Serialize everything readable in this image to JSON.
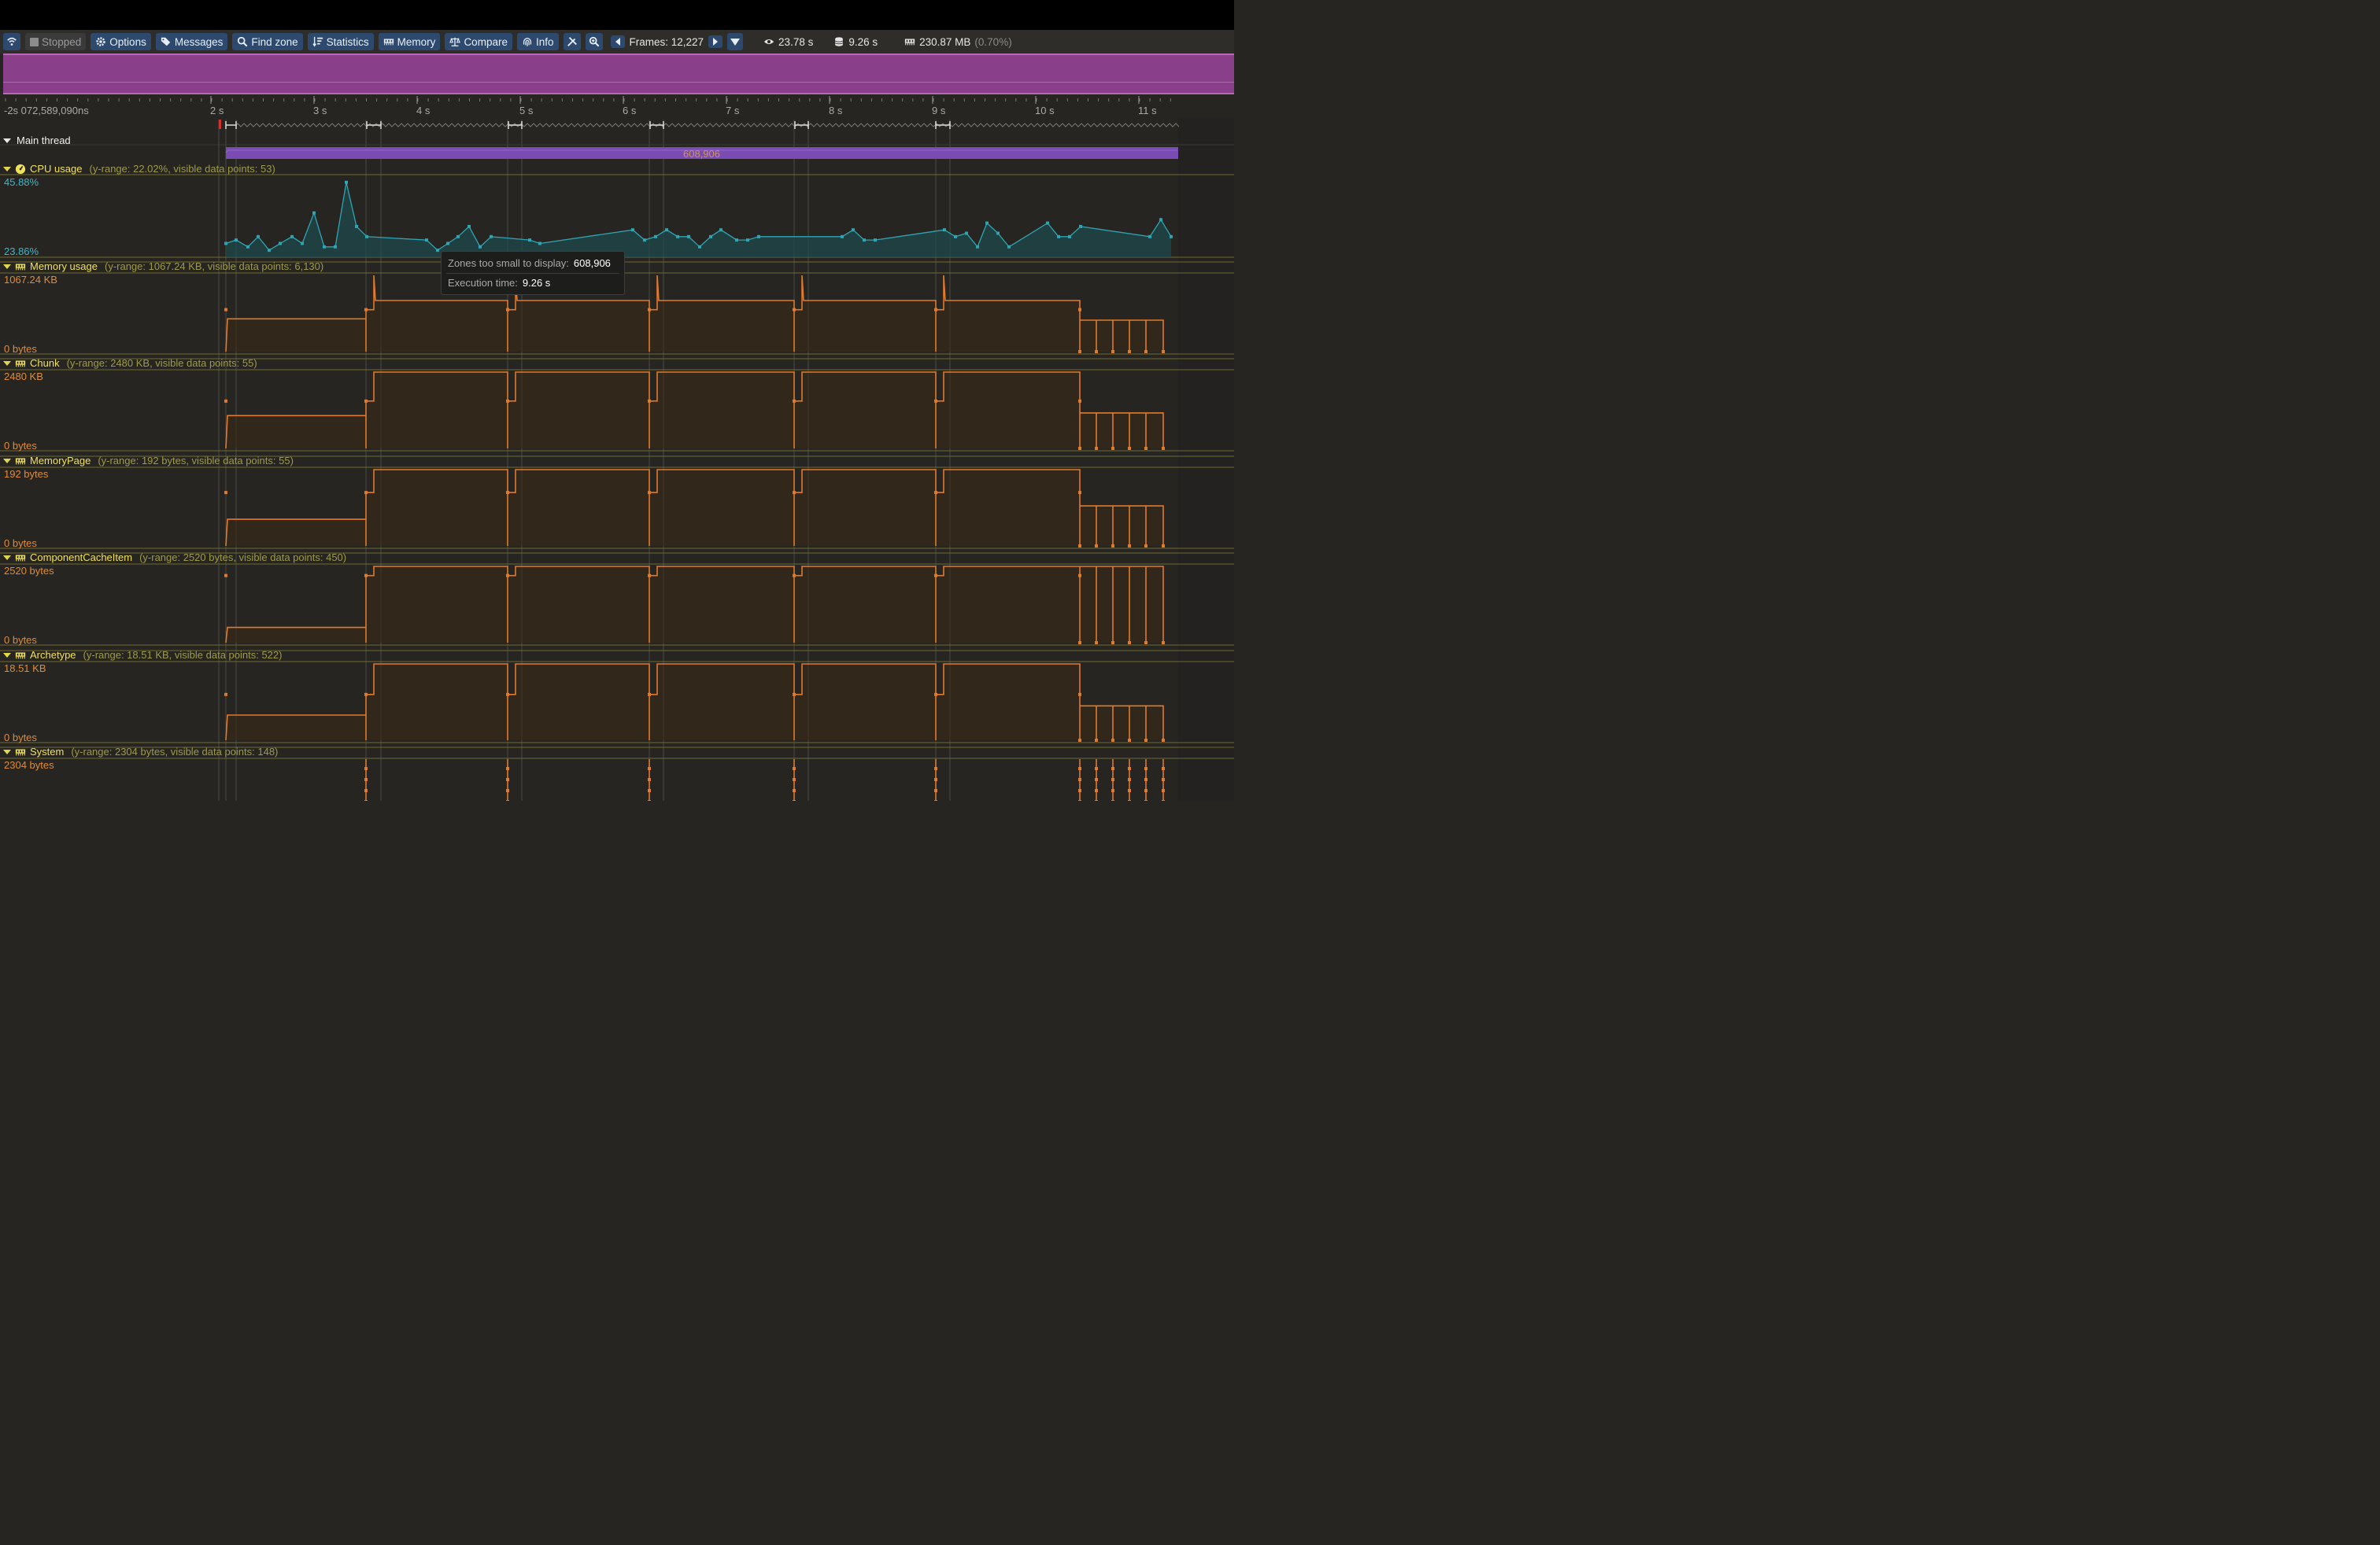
{
  "toolbar": {
    "stopped": "Stopped",
    "options": "Options",
    "messages": "Messages",
    "find_zone": "Find zone",
    "statistics": "Statistics",
    "memory": "Memory",
    "compare": "Compare",
    "info": "Info",
    "frames": "Frames: 12,227",
    "view_time": "23.78 s",
    "capture_time": "9.26 s",
    "memory_total": "230.87 MB",
    "memory_pct": "(0.70%)"
  },
  "ruler": {
    "origin": "-2s 072,589,090ns",
    "ticks": [
      "2 s",
      "3 s",
      "4 s",
      "5 s",
      "6 s",
      "7 s",
      "8 s",
      "9 s",
      "10 s",
      "11 s"
    ]
  },
  "thread": {
    "name": "Main thread",
    "zone_count": "608,906"
  },
  "tooltip": {
    "k1": "Zones too small to display:",
    "v1": "608,906",
    "k2": "Execution time:",
    "v2": "9.26 s"
  },
  "cpu": {
    "name": "CPU usage",
    "meta": "(y-range: 22.02%, visible data points: 53)",
    "max": "45.88%",
    "min": "23.86%"
  },
  "plots": [
    {
      "name": "Memory usage",
      "meta": "(y-range: 1067.24 KB, visible data points: 6,130)",
      "max": "1067.24 KB",
      "min": "0 bytes"
    },
    {
      "name": "Chunk",
      "meta": "(y-range: 2480 KB, visible data points: 55)",
      "max": "2480 KB",
      "min": "0 bytes"
    },
    {
      "name": "MemoryPage",
      "meta": "(y-range: 192 bytes, visible data points: 55)",
      "max": "192 bytes",
      "min": "0 bytes"
    },
    {
      "name": "ComponentCacheItem",
      "meta": "(y-range: 2520 bytes, visible data points: 450)",
      "max": "2520 bytes",
      "min": "0 bytes"
    },
    {
      "name": "Archetype",
      "meta": "(y-range: 18.51 KB, visible data points: 522)",
      "max": "18.51 KB",
      "min": "0 bytes"
    },
    {
      "name": "System",
      "meta": "(y-range: 2304 bytes, visible data points: 148)",
      "max": "2304 bytes",
      "min": ""
    }
  ],
  "chart_data": {
    "type": "line",
    "title": "CPU usage",
    "x_unit": "s",
    "ylim": [
      23.86,
      45.88
    ],
    "values": [
      27,
      28,
      26,
      29,
      25,
      27,
      29,
      27,
      36,
      26,
      26,
      45,
      32,
      29,
      28,
      25,
      27,
      29,
      32,
      26,
      29,
      28,
      27,
      31,
      28,
      29,
      31,
      29,
      29,
      26,
      29,
      31,
      28,
      28,
      29,
      29,
      31,
      28,
      28,
      31,
      29,
      30,
      26,
      33,
      30,
      26,
      33,
      29,
      29,
      32,
      29,
      34,
      29
    ]
  },
  "colors": {
    "cpu_line": "#2fa5b4",
    "plot_line": "#e07a2c",
    "frame_bar": "#8a3f8a",
    "zone_bar": "#7b4bb4",
    "track_title": "#f0e05a"
  }
}
